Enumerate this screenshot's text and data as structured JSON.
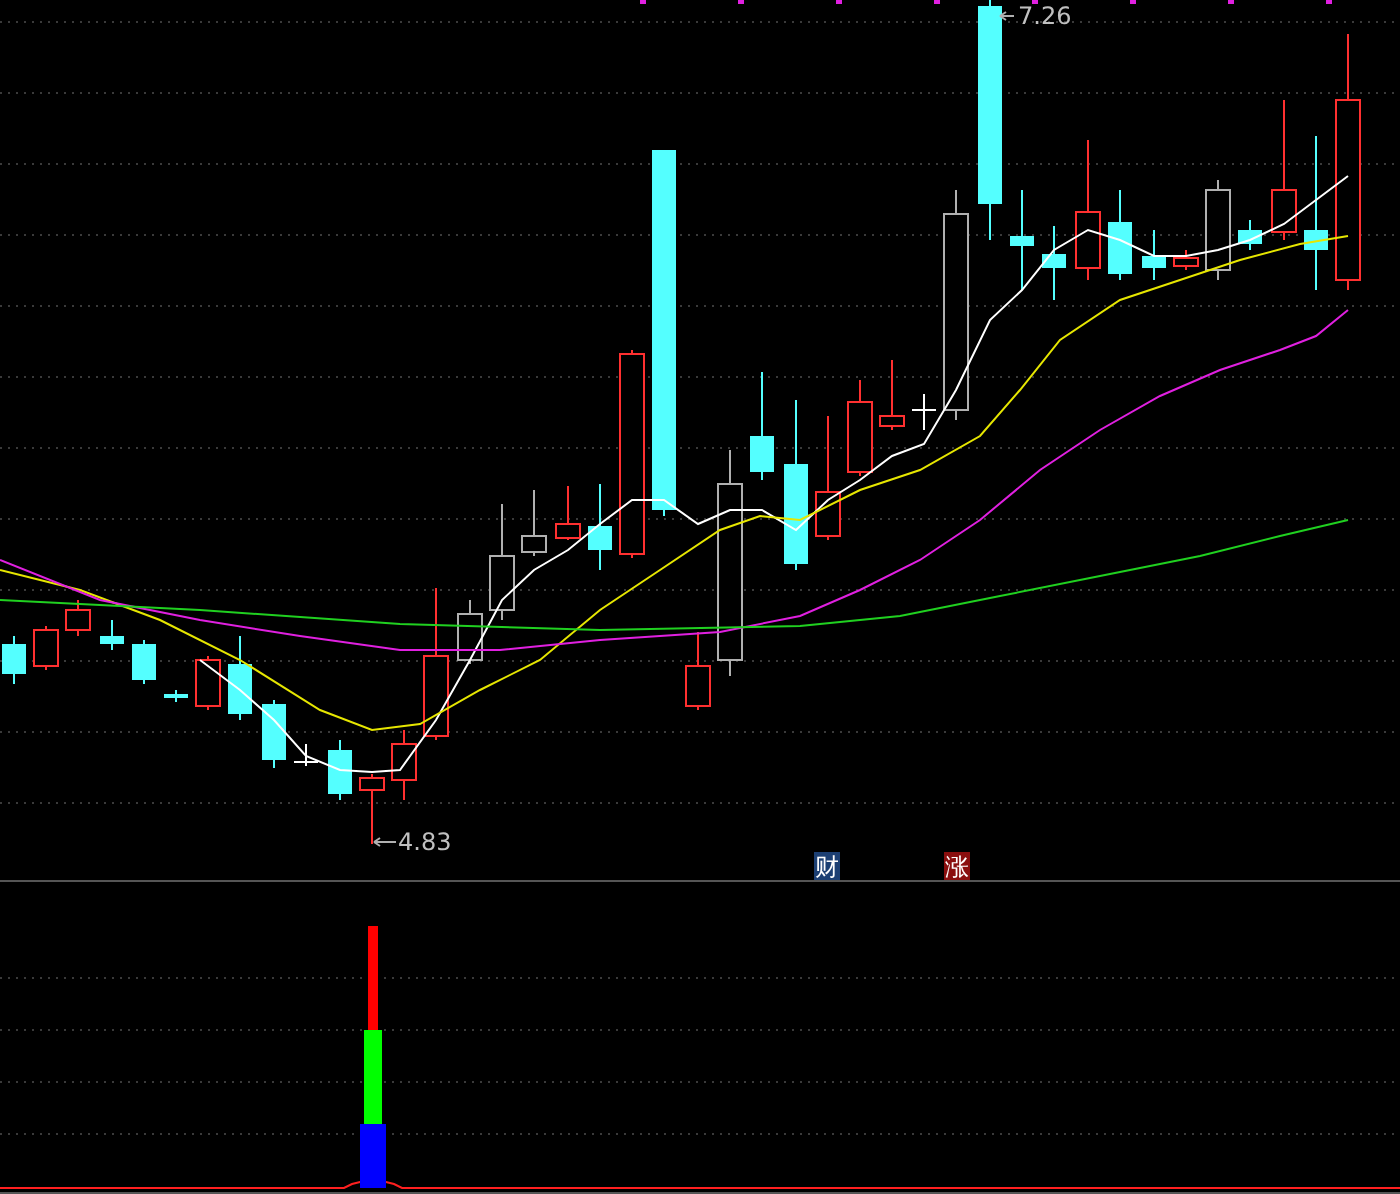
{
  "price_chart": {
    "high_label": "7.26",
    "low_label": "4.83",
    "event_badges": [
      {
        "text": "财",
        "color": "#1c3f73"
      },
      {
        "text": "涨",
        "color": "#8a0e0e"
      }
    ]
  }
}
